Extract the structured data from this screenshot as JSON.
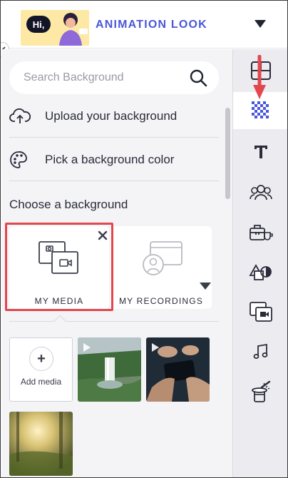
{
  "header": {
    "thumb_text": "Hi,",
    "title": "ANIMATION LOOK"
  },
  "search": {
    "placeholder": "Search Background"
  },
  "actions": {
    "upload": "Upload your background",
    "pick_color": "Pick a background color"
  },
  "section_title": "Choose a background",
  "tiles": {
    "my_media": "MY MEDIA",
    "my_recordings": "MY RECORDINGS"
  },
  "media": {
    "add_label": "Add media",
    "items": [
      "waterfall-video",
      "hands-phone-video",
      "forest-sunlight-image"
    ]
  },
  "toolbar": {
    "tools": [
      "layout-icon",
      "background-icon",
      "text-icon",
      "characters-icon",
      "props-icon",
      "shapes-icon",
      "media-icon",
      "audio-icon",
      "effects-icon"
    ],
    "active": "background-icon"
  },
  "colors": {
    "accent": "#4a57d8",
    "highlight": "#e2474e",
    "active_tool": "#4a57d8"
  }
}
